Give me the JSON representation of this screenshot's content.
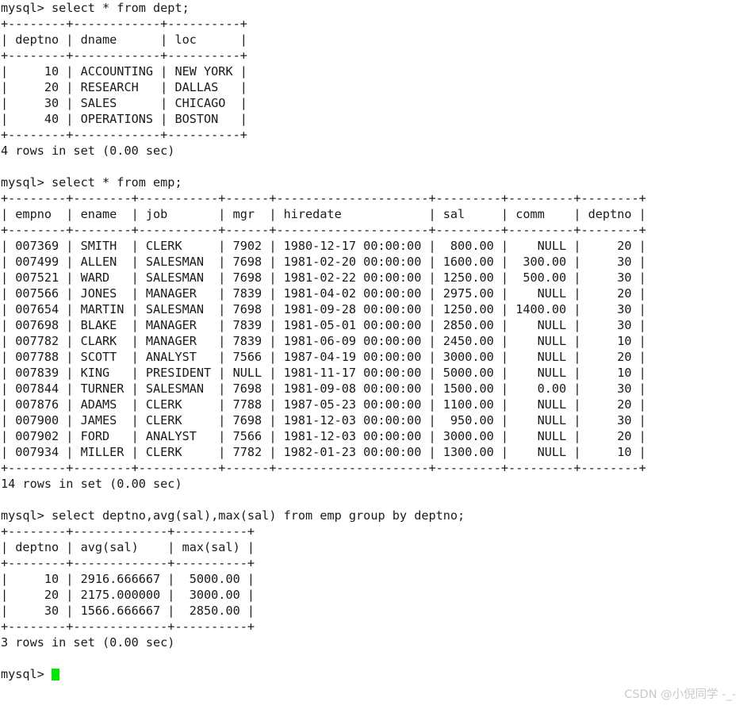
{
  "terminal": {
    "prompt": "mysql> ",
    "cursor_color": "#00e800",
    "background": "#ffffff",
    "foreground": "#1a1a1a",
    "lines": [
      "mysql> select * from dept;",
      "+--------+------------+----------+",
      "| deptno | dname      | loc      |",
      "+--------+------------+----------+",
      "|     10 | ACCOUNTING | NEW YORK |",
      "|     20 | RESEARCH   | DALLAS   |",
      "|     30 | SALES      | CHICAGO  |",
      "|     40 | OPERATIONS | BOSTON   |",
      "+--------+------------+----------+",
      "4 rows in set (0.00 sec)",
      "",
      "mysql> select * from emp;",
      "+--------+--------+-----------+------+---------------------+---------+---------+--------+",
      "| empno  | ename  | job       | mgr  | hiredate            | sal     | comm    | deptno |",
      "+--------+--------+-----------+------+---------------------+---------+---------+--------+",
      "| 007369 | SMITH  | CLERK     | 7902 | 1980-12-17 00:00:00 |  800.00 |    NULL |     20 |",
      "| 007499 | ALLEN  | SALESMAN  | 7698 | 1981-02-20 00:00:00 | 1600.00 |  300.00 |     30 |",
      "| 007521 | WARD   | SALESMAN  | 7698 | 1981-02-22 00:00:00 | 1250.00 |  500.00 |     30 |",
      "| 007566 | JONES  | MANAGER   | 7839 | 1981-04-02 00:00:00 | 2975.00 |    NULL |     20 |",
      "| 007654 | MARTIN | SALESMAN  | 7698 | 1981-09-28 00:00:00 | 1250.00 | 1400.00 |     30 |",
      "| 007698 | BLAKE  | MANAGER   | 7839 | 1981-05-01 00:00:00 | 2850.00 |    NULL |     30 |",
      "| 007782 | CLARK  | MANAGER   | 7839 | 1981-06-09 00:00:00 | 2450.00 |    NULL |     10 |",
      "| 007788 | SCOTT  | ANALYST   | 7566 | 1987-04-19 00:00:00 | 3000.00 |    NULL |     20 |",
      "| 007839 | KING   | PRESIDENT | NULL | 1981-11-17 00:00:00 | 5000.00 |    NULL |     10 |",
      "| 007844 | TURNER | SALESMAN  | 7698 | 1981-09-08 00:00:00 | 1500.00 |    0.00 |     30 |",
      "| 007876 | ADAMS  | CLERK     | 7788 | 1987-05-23 00:00:00 | 1100.00 |    NULL |     20 |",
      "| 007900 | JAMES  | CLERK     | 7698 | 1981-12-03 00:00:00 |  950.00 |    NULL |     30 |",
      "| 007902 | FORD   | ANALYST   | 7566 | 1981-12-03 00:00:00 | 3000.00 |    NULL |     20 |",
      "| 007934 | MILLER | CLERK     | 7782 | 1982-01-23 00:00:00 | 1300.00 |    NULL |     10 |",
      "+--------+--------+-----------+------+---------------------+---------+---------+--------+",
      "14 rows in set (0.00 sec)",
      "",
      "mysql> select deptno,avg(sal),max(sal) from emp group by deptno;",
      "+--------+-------------+----------+",
      "| deptno | avg(sal)    | max(sal) |",
      "+--------+-------------+----------+",
      "|     10 | 2916.666667 |  5000.00 |",
      "|     20 | 2175.000000 |  3000.00 |",
      "|     30 | 1566.666667 |  2850.00 |",
      "+--------+-------------+----------+",
      "3 rows in set (0.00 sec)",
      ""
    ],
    "final_prompt": "mysql> "
  },
  "queries": [
    {
      "sql": "select * from dept;",
      "result_footer": "4 rows in set (0.00 sec)",
      "columns": [
        "deptno",
        "dname",
        "loc"
      ],
      "rows": [
        [
          "10",
          "ACCOUNTING",
          "NEW YORK"
        ],
        [
          "20",
          "RESEARCH",
          "DALLAS"
        ],
        [
          "30",
          "SALES",
          "CHICAGO"
        ],
        [
          "40",
          "OPERATIONS",
          "BOSTON"
        ]
      ]
    },
    {
      "sql": "select * from emp;",
      "result_footer": "14 rows in set (0.00 sec)",
      "columns": [
        "empno",
        "ename",
        "job",
        "mgr",
        "hiredate",
        "sal",
        "comm",
        "deptno"
      ],
      "rows": [
        [
          "007369",
          "SMITH",
          "CLERK",
          "7902",
          "1980-12-17 00:00:00",
          "800.00",
          "NULL",
          "20"
        ],
        [
          "007499",
          "ALLEN",
          "SALESMAN",
          "7698",
          "1981-02-20 00:00:00",
          "1600.00",
          "300.00",
          "30"
        ],
        [
          "007521",
          "WARD",
          "SALESMAN",
          "7698",
          "1981-02-22 00:00:00",
          "1250.00",
          "500.00",
          "30"
        ],
        [
          "007566",
          "JONES",
          "MANAGER",
          "7839",
          "1981-04-02 00:00:00",
          "2975.00",
          "NULL",
          "20"
        ],
        [
          "007654",
          "MARTIN",
          "SALESMAN",
          "7698",
          "1981-09-28 00:00:00",
          "1250.00",
          "1400.00",
          "30"
        ],
        [
          "007698",
          "BLAKE",
          "MANAGER",
          "7839",
          "1981-05-01 00:00:00",
          "2850.00",
          "NULL",
          "30"
        ],
        [
          "007782",
          "CLARK",
          "MANAGER",
          "7839",
          "1981-06-09 00:00:00",
          "2450.00",
          "NULL",
          "10"
        ],
        [
          "007788",
          "SCOTT",
          "ANALYST",
          "7566",
          "1987-04-19 00:00:00",
          "3000.00",
          "NULL",
          "20"
        ],
        [
          "007839",
          "KING",
          "PRESIDENT",
          "NULL",
          "1981-11-17 00:00:00",
          "5000.00",
          "NULL",
          "10"
        ],
        [
          "007844",
          "TURNER",
          "SALESMAN",
          "7698",
          "1981-09-08 00:00:00",
          "1500.00",
          "0.00",
          "30"
        ],
        [
          "007876",
          "ADAMS",
          "CLERK",
          "7788",
          "1987-05-23 00:00:00",
          "1100.00",
          "NULL",
          "20"
        ],
        [
          "007900",
          "JAMES",
          "CLERK",
          "7698",
          "1981-12-03 00:00:00",
          "950.00",
          "NULL",
          "30"
        ],
        [
          "007902",
          "FORD",
          "ANALYST",
          "7566",
          "1981-12-03 00:00:00",
          "3000.00",
          "NULL",
          "20"
        ],
        [
          "007934",
          "MILLER",
          "CLERK",
          "7782",
          "1982-01-23 00:00:00",
          "1300.00",
          "NULL",
          "10"
        ]
      ]
    },
    {
      "sql": "select deptno,avg(sal),max(sal) from emp group by deptno;",
      "result_footer": "3 rows in set (0.00 sec)",
      "columns": [
        "deptno",
        "avg(sal)",
        "max(sal)"
      ],
      "rows": [
        [
          "10",
          "2916.666667",
          "5000.00"
        ],
        [
          "20",
          "2175.000000",
          "3000.00"
        ],
        [
          "30",
          "1566.666667",
          "2850.00"
        ]
      ]
    }
  ],
  "watermark": {
    "text": "CSDN @小倪同学 -_-",
    "color": "#c9c9c9"
  }
}
